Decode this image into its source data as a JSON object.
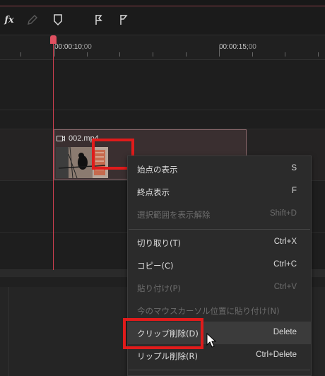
{
  "toolbar": {
    "fx_label": "fx",
    "icons": [
      "fx-icon",
      "pencil-icon",
      "shield-icon",
      "flag-marker-icon",
      "flag-icon"
    ]
  },
  "ruler": {
    "timecode_10_main": "00:00:10;",
    "timecode_10_frames": "00",
    "timecode_15_main": "00:00:15;",
    "timecode_15_frames": "00"
  },
  "clip": {
    "name": "002.mp4"
  },
  "context_menu": {
    "items": [
      {
        "label": "始点の表示",
        "shortcut": "S",
        "enabled": true
      },
      {
        "label": "終点表示",
        "shortcut": "F",
        "enabled": true
      },
      {
        "label": "選択範囲を表示解除",
        "shortcut": "Shift+D",
        "enabled": false
      },
      {
        "label": "切り取り(T)",
        "shortcut": "Ctrl+X",
        "enabled": true
      },
      {
        "label": "コピー(C)",
        "shortcut": "Ctrl+C",
        "enabled": true
      },
      {
        "label": "貼り付け(P)",
        "shortcut": "Ctrl+V",
        "enabled": false
      },
      {
        "label": "今のマウスカーソル位置に貼り付け(N)",
        "shortcut": "",
        "enabled": false
      },
      {
        "label": "クリップ削除(D)",
        "shortcut": "Delete",
        "enabled": true,
        "selected": true
      },
      {
        "label": "リップル削除(R)",
        "shortcut": "Ctrl+Delete",
        "enabled": true
      }
    ]
  },
  "colors": {
    "playhead": "#d04050",
    "highlight_box": "#e01b1b",
    "menu_bg": "#2b2b2b"
  }
}
